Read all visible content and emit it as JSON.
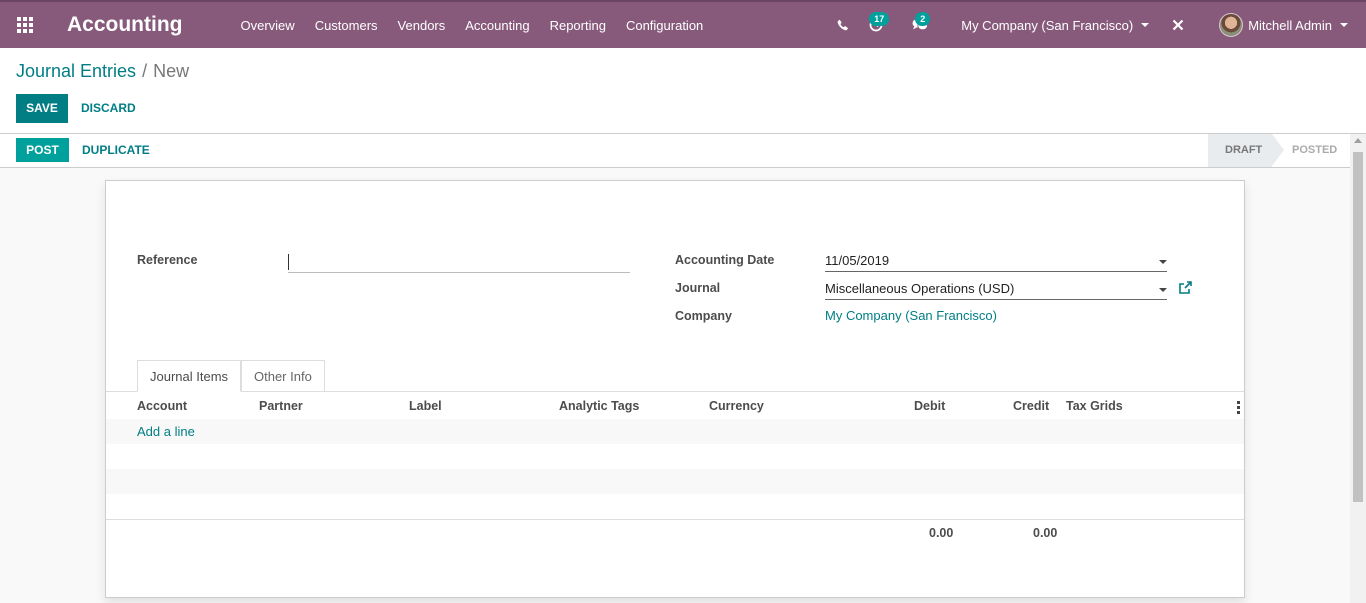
{
  "navbar": {
    "app_name": "Accounting",
    "menu": [
      "Overview",
      "Customers",
      "Vendors",
      "Accounting",
      "Reporting",
      "Configuration"
    ],
    "activity_count": "17",
    "message_count": "2",
    "company": "My Company (San Francisco)",
    "user": "Mitchell Admin"
  },
  "breadcrumb": {
    "parent": "Journal Entries",
    "separator": "/",
    "current": "New"
  },
  "buttons": {
    "save": "SAVE",
    "discard": "DISCARD",
    "post": "POST",
    "duplicate": "DUPLICATE"
  },
  "status": {
    "stages": [
      "DRAFT",
      "POSTED"
    ],
    "active": "DRAFT"
  },
  "form": {
    "reference_label": "Reference",
    "reference_value": "",
    "accounting_date_label": "Accounting Date",
    "accounting_date": "11/05/2019",
    "journal_label": "Journal",
    "journal": "Miscellaneous Operations (USD)",
    "company_label": "Company",
    "company": "My Company (San Francisco)"
  },
  "tabs": [
    "Journal Items",
    "Other Info"
  ],
  "table": {
    "columns": [
      "Account",
      "Partner",
      "Label",
      "Analytic Tags",
      "Currency",
      "Debit",
      "Credit",
      "Tax Grids"
    ],
    "add_line": "Add a line",
    "total_debit": "0.00",
    "total_credit": "0.00"
  },
  "colors": {
    "navbar": "#875a7b",
    "primary": "#017e84",
    "accent": "#00a09d"
  },
  "icons": [
    "apps-grid-icon",
    "phone-icon",
    "activity-clock-icon",
    "chat-icon",
    "debug-close-icon",
    "external-link-icon",
    "kebab-menu-icon"
  ]
}
